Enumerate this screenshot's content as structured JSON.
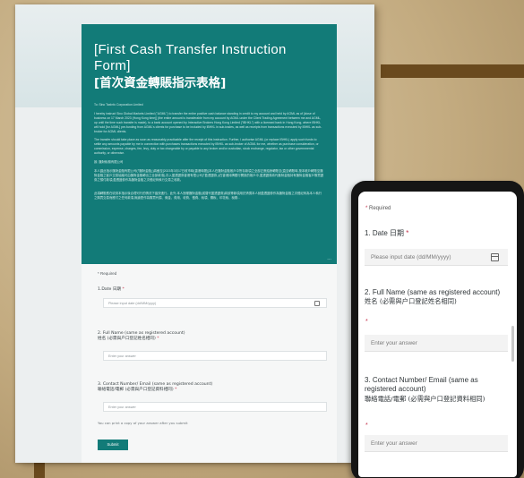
{
  "desktop_form": {
    "title_en": "[First Cash Transfer Instruction Form]",
    "title_zh": "[首次資金轉賬指示表格]",
    "addressee": "To: Sino TaxInfo Corporation Limited",
    "para1": "I hereby instruct Sino Global Markets Limited (\"AGML\") to transfer the entire positive cash balance standing in credit to my account and held by AGML as of [close of business on 17 March 2023 (Hong Kong time)] (the entire amount is transferable from my account by AGML under the Client Trading Agreement between me and AGML, up until the time such transfer is made), to a bank account opened by Interactive Brokers Hong Kong Limited (\"IBHKL\") with a licensed bank in Hong Kong, where IBHKL will hold [for AGML] pre-funding from AGML's clients for purchase to be included by IBHKL in sub-trades, as well as receipts from transactions executed by IBHKL as sub-broker for AGML clients.",
    "para2": "The transfer should take place as soon as reasonably practicable after the receipt of this instruction. Further, I authorise AGML (or replace IBHKL) apply such funds to settle any amounts payable by me in connection with purchases transactions executed by IBHKL as sub-broker of AGML for me, whether as purchase consideration, or commission, expense, charges, fee, levy, duty or tax chargeable by or payable to any broker and/or custodian, stock exchange, regulator, tax or other governmental authority, or otherwise.",
    "addressee_zh": "致: 匯財稅務有限公司",
    "para_zh1": "本人謹此指示匯財金融有限公司(「匯財金融」)將截至[2023年3月17日收市時(香港時間)]本人在匯財金融帳戶中所存款項之全部正數結餘轉賬至(直至轉賬時,按本帳戶轉賬至匯財金融之客戶交易協議可由匯財金融轉出之全部款項),存入盈透證券香港有限公司(「盈透證券」)在香港持牌銀行開設的帳戶中,盈透證券將代匯財金融持有匯財金融客戶購買證券之預付款項,盈透證券作為匯財金融之次經紀商執行交易之收款。",
    "para_zh2": "此項轉賬應在收到本指示後合理可行的情況下儘快進行。此外,本人授權匯財金融(或替代盈透證券)將該等款項用於清償本人就盈透證券作為匯財金融之次經紀商為本人執行之購買交易而應付之任何款項,無論是作為購買代價、佣金、費用、收費、徵費、稅項、關稅、印花稅、稅務...",
    "more": "...",
    "required": "* Required",
    "q1": "1.Date 日期",
    "q1_placeholder": "Please input date (dd/MM/yyyy)",
    "q2_en": "2. Full Name (same as registered account)",
    "q2_zh": "姓名 (必需與户口登記姓名相同)",
    "q2_placeholder": "Enter your answer",
    "q3_en": "3. Contact Number/ Email (same as registered account)",
    "q3_zh": "聯絡電話/電郵 (必需與户口登記資料相同)",
    "q3_placeholder": "Enter your answer",
    "note": "You can print a copy of your answer after you submit",
    "submit": "Submit"
  },
  "mobile_form": {
    "required": "Required",
    "q1": "1. Date 日期",
    "q1_placeholder": "Please input date (dd/MM/yyyy)",
    "q2_en": "2. Full Name (same as registered account)",
    "q2_zh": "姓名 (必需與户口登記姓名相同)",
    "q2_placeholder": "Enter your answer",
    "q3_en": "3. Contact Number/ Email (same as registered account)",
    "q3_zh": "聯絡電話/電郵 (必需與户口登記資料相同)",
    "q3_placeholder": "Enter your answer"
  },
  "colors": {
    "accent": "#127b78",
    "required_star": "#c4314b",
    "background": "#c3ab80"
  },
  "icons": {
    "calendar": "calendar-icon"
  }
}
